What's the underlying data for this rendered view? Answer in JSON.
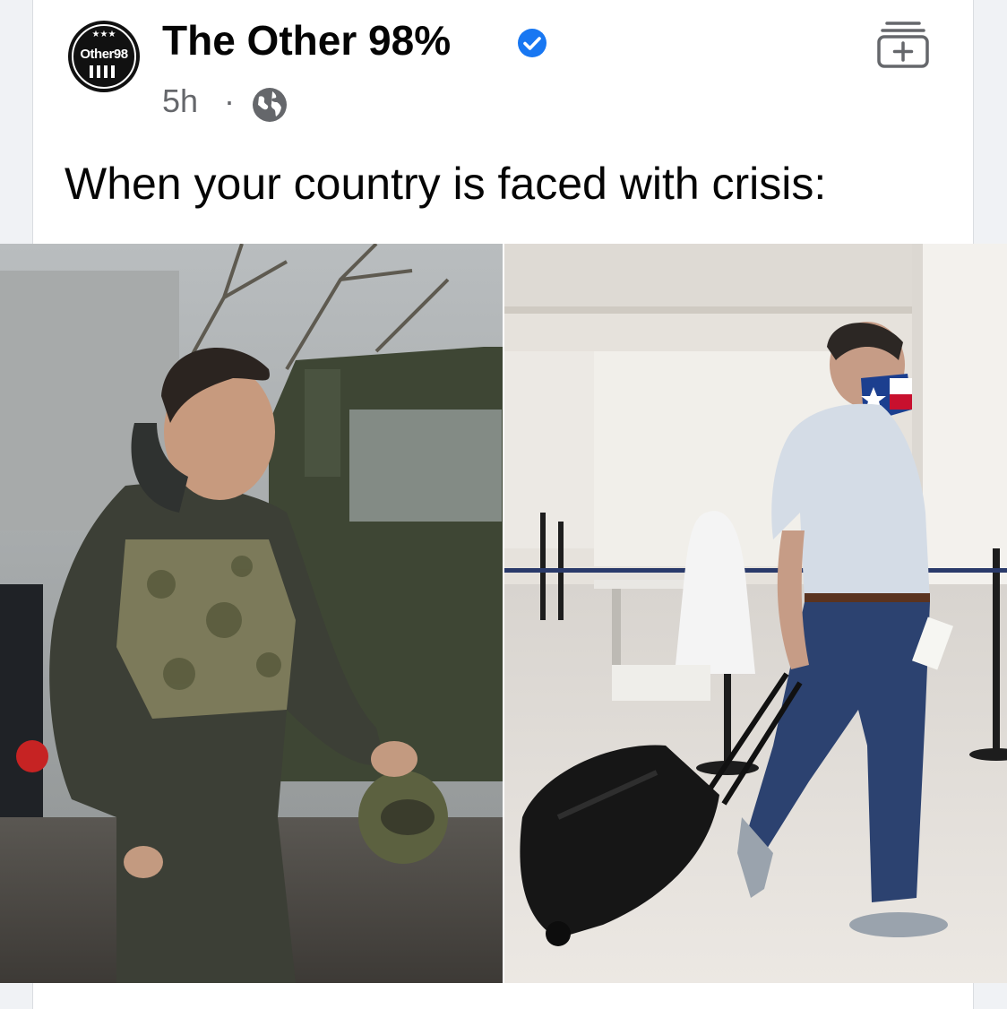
{
  "post": {
    "page_name": "The Other 98%",
    "avatar_text": "Other98",
    "timestamp": "5h",
    "separator": "·",
    "privacy_icon": "globe-icon",
    "verified_icon": "verified-badge-icon",
    "save_icon": "save-to-collection-icon",
    "text": "When your country is faced with crisis:"
  },
  "images": {
    "left": "photo-man-in-military-gear-with-helmet",
    "right": "photo-man-with-suitcase-in-airport"
  },
  "colors": {
    "verified_blue": "#1877f2",
    "meta_gray": "#65676b",
    "text_black": "#050505"
  }
}
